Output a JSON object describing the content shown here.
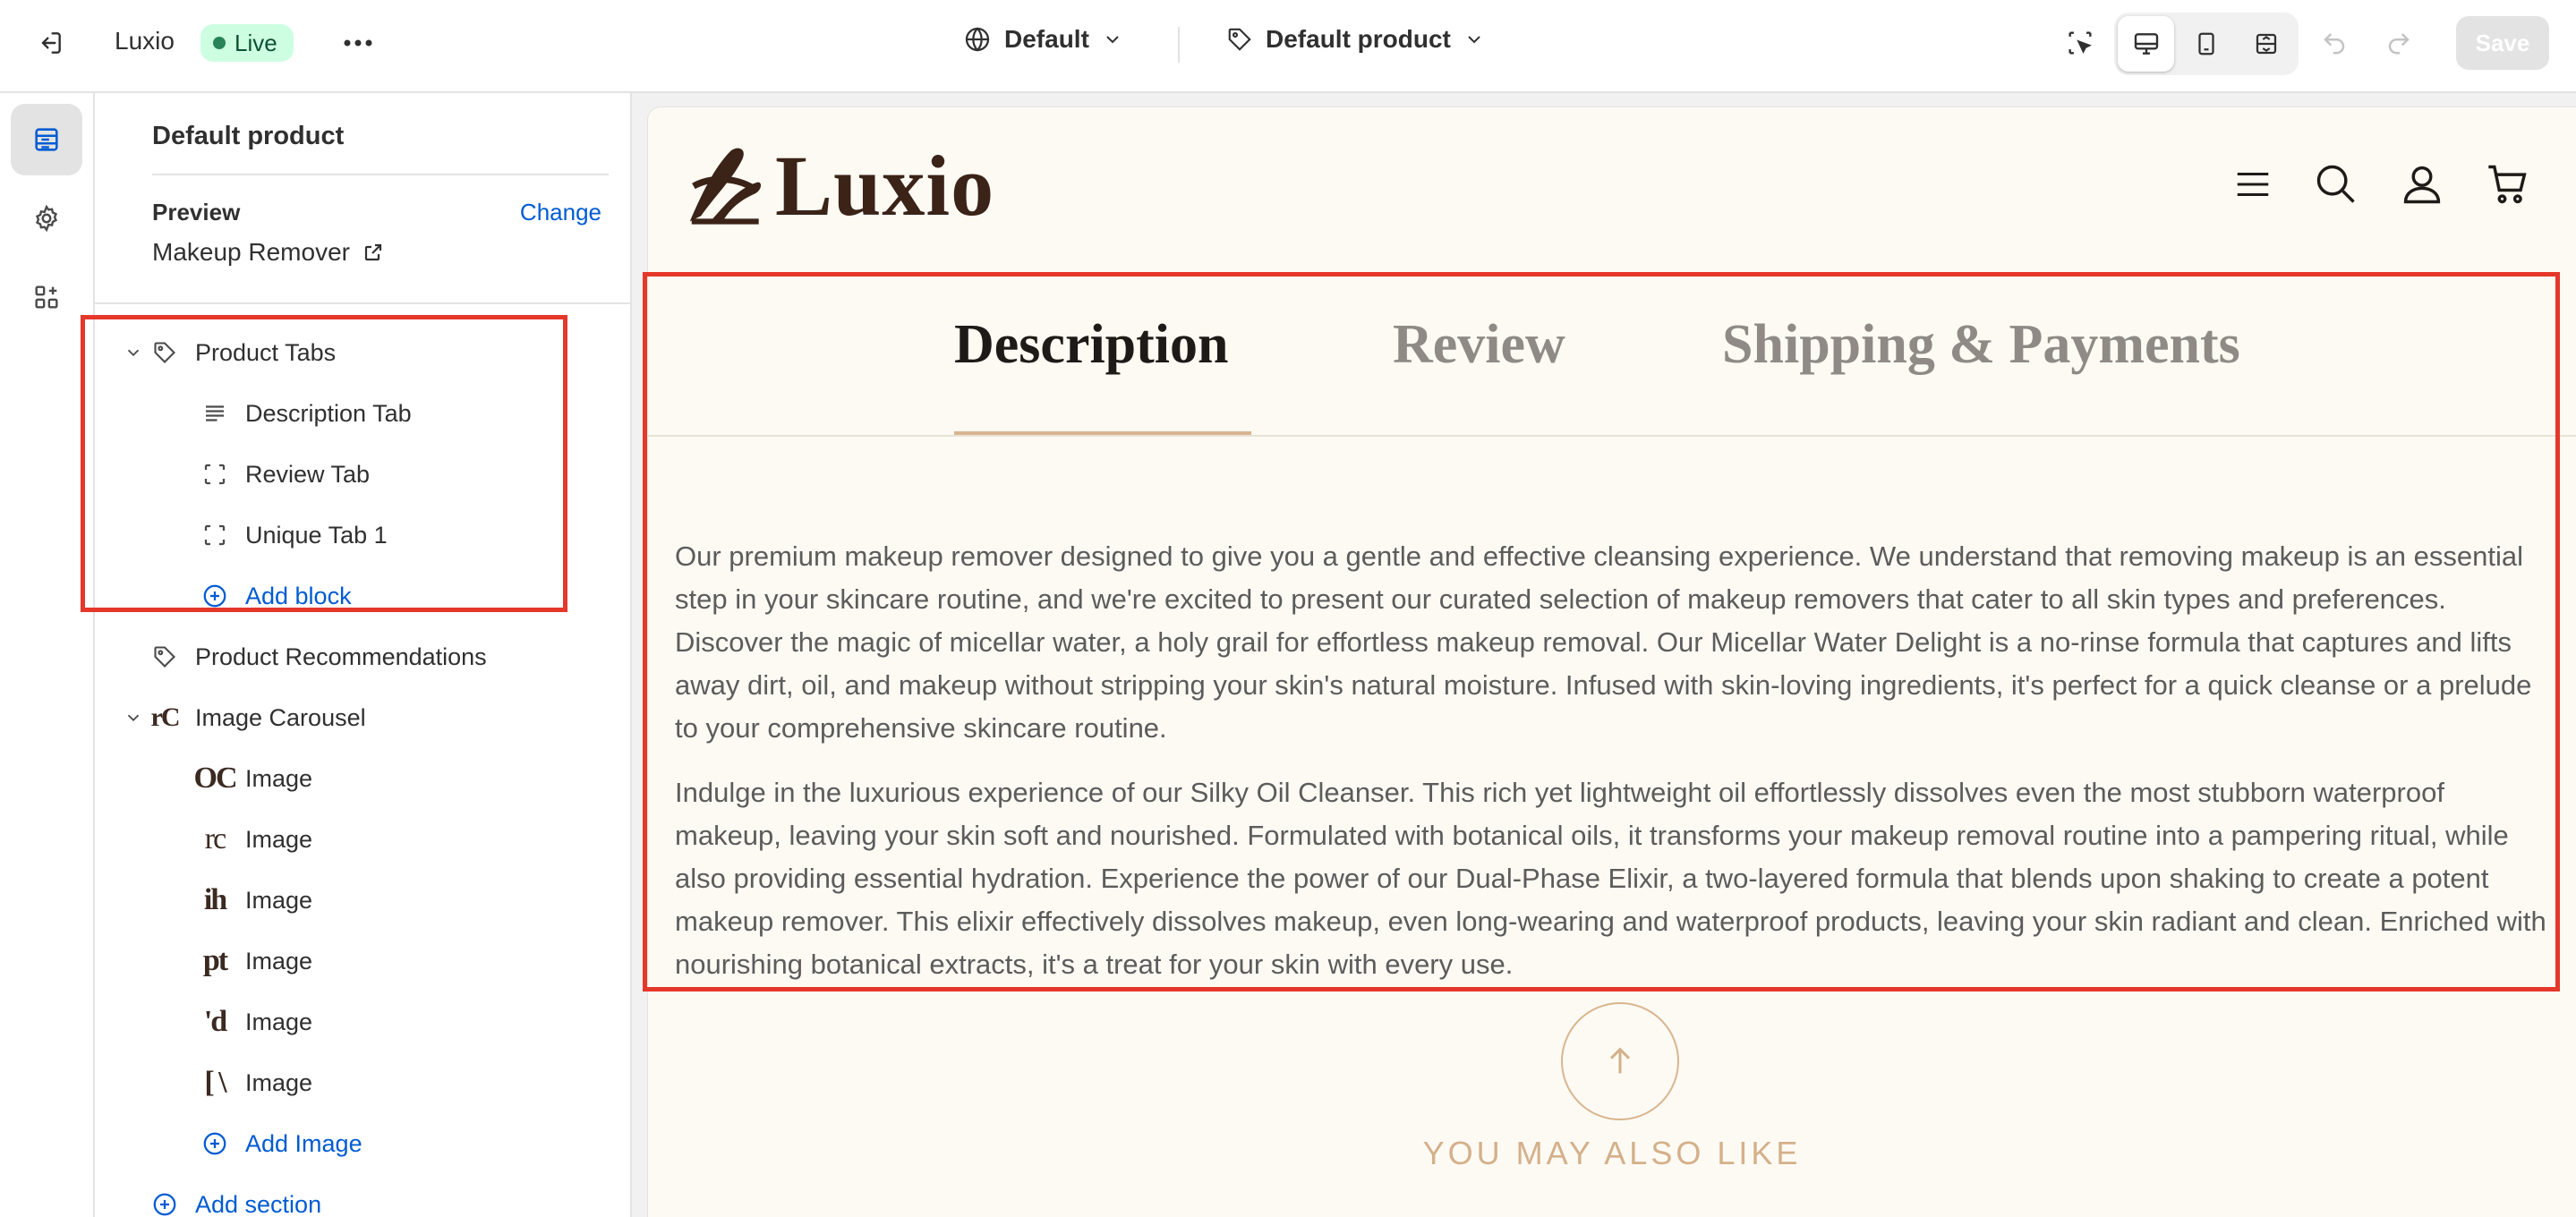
{
  "topbar": {
    "store_name": "Luxio",
    "status_badge": "Live",
    "theme_selector": "Default",
    "template_selector": "Default product",
    "save_label": "Save"
  },
  "sidebar": {
    "title": "Default product",
    "preview_label": "Preview",
    "change_label": "Change",
    "preview_value": "Makeup Remover",
    "sections": {
      "product_tabs": "Product Tabs",
      "description_tab": "Description Tab",
      "review_tab": "Review Tab",
      "unique_tab": "Unique Tab 1",
      "add_block": "Add block",
      "product_recommendations": "Product Recommendations",
      "image_carousel": "Image Carousel",
      "images": [
        {
          "label": "Image",
          "thumb": "OC"
        },
        {
          "label": "Image",
          "thumb": "rc"
        },
        {
          "label": "Image",
          "thumb": "ih"
        },
        {
          "label": "Image",
          "thumb": "pt"
        },
        {
          "label": "Image",
          "thumb": "'d"
        },
        {
          "label": "Image",
          "thumb": "[ \\"
        }
      ],
      "image_carousel_thumb": "rC",
      "add_image": "Add Image",
      "add_section": "Add section"
    }
  },
  "preview": {
    "logo_text": "Luxio",
    "tabs": [
      "Description",
      "Review",
      "Shipping & Payments"
    ],
    "paragraphs": [
      "Our premium makeup remover designed to give you a gentle and effective cleansing experience. We understand that removing makeup is an essential step in your skincare routine, and we're excited to present our curated selection of makeup removers that cater to all skin types and preferences. Discover the magic of micellar water, a holy grail for effortless makeup removal. Our Micellar Water Delight is a no-rinse formula that captures and lifts away dirt, oil, and makeup without stripping your skin's natural moisture. Infused with skin-loving ingredients, it's perfect for a quick cleanse or a prelude to your comprehensive skincare routine.",
      "Indulge in the luxurious experience of our Silky Oil Cleanser. This rich yet lightweight oil effortlessly dissolves even the most stubborn waterproof makeup, leaving your skin soft and nourished. Formulated with botanical oils, it transforms your makeup removal routine into a pampering ritual, while also providing essential hydration. Experience the power of our Dual-Phase Elixir, a two-layered formula that blends upon shaking to create a potent makeup remover. This elixir effectively dissolves makeup, even long-wearing and waterproof products, leaving your skin radiant and clean. Enriched with nourishing botanical extracts, it's a treat for your skin with every use."
    ],
    "also_like": "YOU MAY ALSO LIKE"
  },
  "colors": {
    "accent_link": "#005bd3",
    "highlight": "#e5372a",
    "brand_gold": "#d9b58e",
    "brand_dark": "#3b2318"
  }
}
